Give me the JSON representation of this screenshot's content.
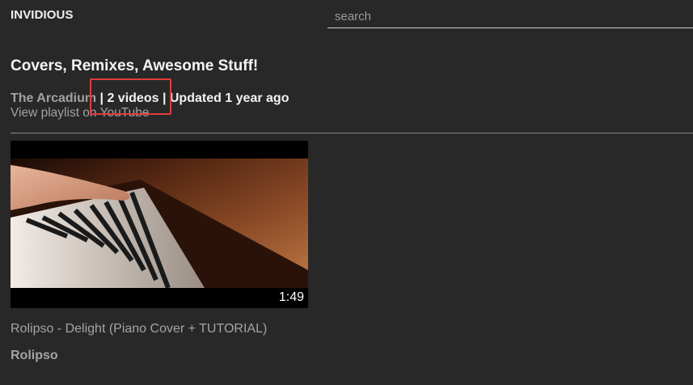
{
  "header": {
    "brand": "INVIDIOUS",
    "search_placeholder": "search"
  },
  "playlist": {
    "title": "Covers, Remixes, Awesome Stuff!",
    "author": "The Arcadium",
    "stats": " | 2 videos | Updated 1 year ago",
    "view_on_youtube": "View playlist on YouTube"
  },
  "videos": [
    {
      "title": "Rolipso - Delight (Piano Cover + TUTORIAL)",
      "channel": "Rolipso",
      "duration": "1:49",
      "thumbnail_icon": "piano-keys-thumbnail"
    }
  ],
  "colors": {
    "background": "#282828",
    "highlight": "#e03c3c",
    "muted_text": "#a2a2a2"
  }
}
